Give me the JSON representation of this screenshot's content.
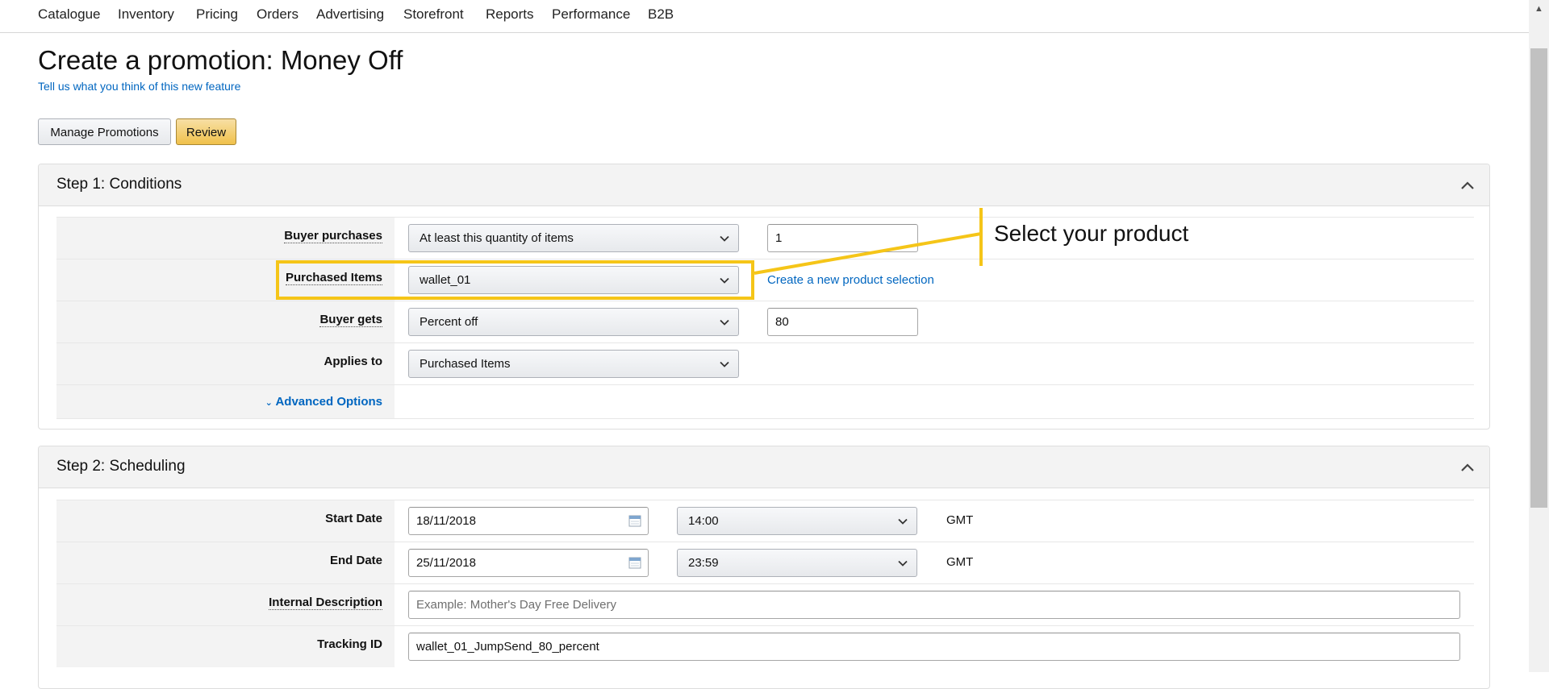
{
  "nav": {
    "items": [
      "Catalogue",
      "Inventory",
      "Pricing",
      "Orders",
      "Advertising",
      "Storefront",
      "Reports",
      "Performance",
      "B2B"
    ]
  },
  "page": {
    "title": "Create a promotion: Money Off",
    "feedback_link": "Tell us what you think of this new feature"
  },
  "actions": {
    "manage_label": "Manage Promotions",
    "review_label": "Review"
  },
  "step1": {
    "title": "Step 1: Conditions",
    "buyer_purchases": {
      "label": "Buyer purchases",
      "select_value": "At least this quantity of items",
      "input_value": "1"
    },
    "purchased_items": {
      "label": "Purchased Items",
      "select_value": "wallet_01",
      "link": "Create a new product selection"
    },
    "buyer_gets": {
      "label": "Buyer gets",
      "select_value": "Percent off",
      "input_value": "80"
    },
    "applies_to": {
      "label": "Applies to",
      "select_value": "Purchased Items"
    },
    "advanced_options": "Advanced Options"
  },
  "step2": {
    "title": "Step 2: Scheduling",
    "start_date": {
      "label": "Start Date",
      "date": "18/11/2018",
      "time": "14:00",
      "tz": "GMT"
    },
    "end_date": {
      "label": "End Date",
      "date": "25/11/2018",
      "time": "23:59",
      "tz": "GMT"
    },
    "internal_description": {
      "label": "Internal Description",
      "placeholder": "Example: Mother's Day Free Delivery"
    },
    "tracking_id": {
      "label": "Tracking ID",
      "value": "wallet_01_JumpSend_80_percent"
    }
  },
  "annotation": {
    "text": "Select your product",
    "color": "#f5c518"
  },
  "icons": {
    "collapse": "chevron-up-icon",
    "dropdown": "chevron-down-icon",
    "calendar": "calendar-icon",
    "scroll_up": "scroll-up-arrow-icon"
  }
}
